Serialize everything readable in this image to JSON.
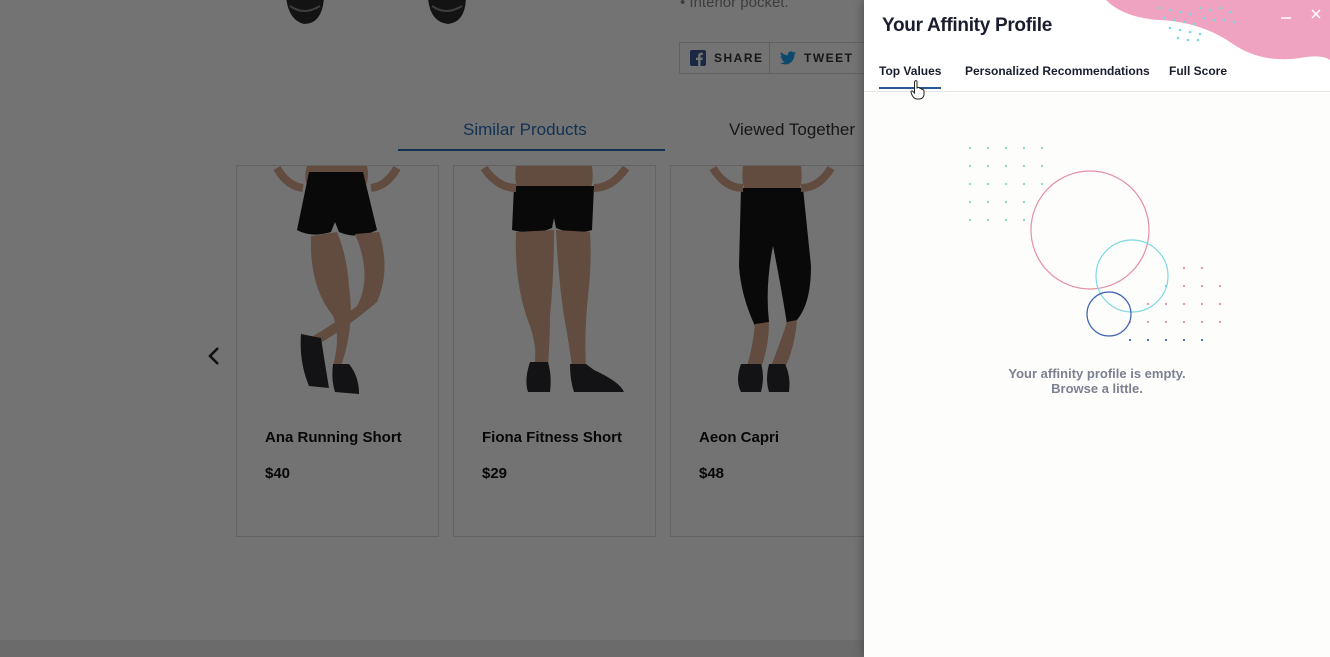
{
  "store": {
    "feature_text": "• Interior pocket.",
    "share_buttons": [
      {
        "label": "SHARE",
        "icon": "facebook-icon"
      },
      {
        "label": "TWEET",
        "icon": "twitter-icon"
      }
    ],
    "product_tabs": [
      {
        "label": "Similar Products",
        "active": true
      },
      {
        "label": "Viewed Together",
        "active": false
      }
    ],
    "products": [
      {
        "name": "Ana Running Short",
        "price": "$40",
        "garment": "shorts"
      },
      {
        "name": "Fiona Fitness Short",
        "price": "$29",
        "garment": "shorts"
      },
      {
        "name": "Aeon Capri",
        "price": "$48",
        "garment": "capri"
      }
    ],
    "prev_icon": "chevron-left-icon"
  },
  "panel": {
    "title": "Your Affinity Profile",
    "minimize_icon": "minimize-icon",
    "close_icon": "close-icon",
    "tabs": [
      {
        "label": "Top Values",
        "active": true
      },
      {
        "label": "Personalized Recommendations",
        "active": false
      },
      {
        "label": "Full Score",
        "active": false
      }
    ],
    "empty_line1": "Your affinity profile is empty.",
    "empty_line2": "Browse a little."
  },
  "colors": {
    "accent_blue": "#2c6fb7",
    "panel_tab_underline": "#2a5596",
    "blob_pink": "#f0a3c1",
    "circle_pink": "#e58fa6",
    "circle_cyan": "#7fd8e0",
    "circle_blue": "#3d63b3"
  }
}
